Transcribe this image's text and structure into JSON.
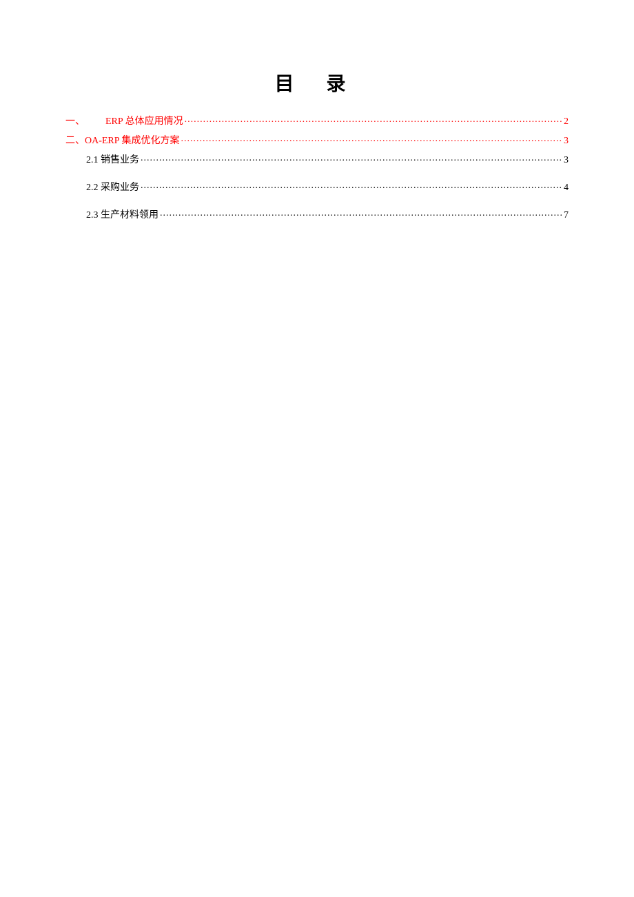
{
  "title": "目 录",
  "toc": {
    "items": [
      {
        "label": "一、",
        "spacer": true,
        "text": "ERP 总体应用情况",
        "page": "2",
        "level": 1,
        "color": "red"
      },
      {
        "label": "二、OA-ERP 集成优化方案",
        "spacer": false,
        "text": "",
        "page": "3",
        "level": 1,
        "color": "red"
      },
      {
        "label": "2.1 销售业务",
        "spacer": false,
        "text": "",
        "page": "3",
        "level": 2,
        "color": "black"
      },
      {
        "label": "2.2 采购业务",
        "spacer": false,
        "text": "",
        "page": "4",
        "level": 2,
        "color": "black"
      },
      {
        "label": "2.3 生产材料领用",
        "spacer": false,
        "text": "",
        "page": "7",
        "level": 2,
        "color": "black"
      }
    ]
  }
}
